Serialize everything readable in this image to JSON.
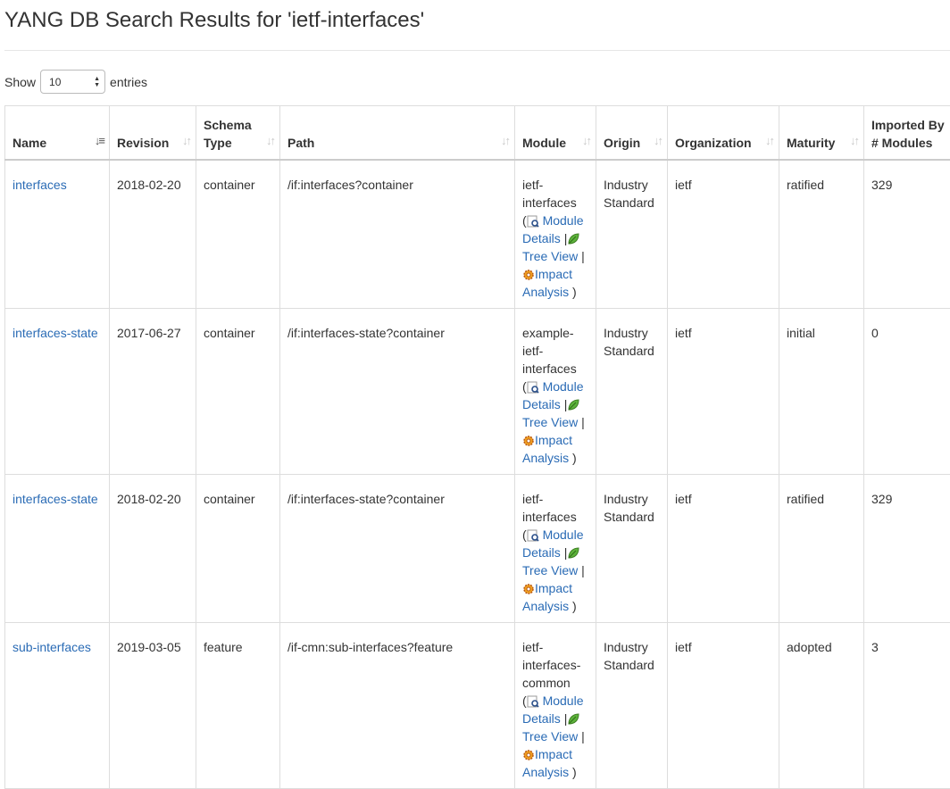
{
  "page": {
    "title": "YANG DB Search Results for 'ietf-interfaces'"
  },
  "length": {
    "show": "Show",
    "value": "10",
    "entries": "entries"
  },
  "columns": [
    "Name",
    "Revision",
    "Schema Type",
    "Path",
    "Module",
    "Origin",
    "Organization",
    "Maturity",
    "Imported By # Modules"
  ],
  "links": {
    "module_details": "Module Details",
    "tree_view": "Tree View",
    "impact_analysis": "Impact Analysis",
    "open_paren": "(",
    "close_paren": ")",
    "sep": "|"
  },
  "rows": [
    {
      "name": "interfaces",
      "revision": "2018-02-20",
      "schema_type": "container",
      "path": "/if:interfaces?container",
      "module": "ietf-interfaces",
      "origin": "Industry Standard",
      "organization": "ietf",
      "maturity": "ratified",
      "imported_by": "329"
    },
    {
      "name": "interfaces-state",
      "revision": "2017-06-27",
      "schema_type": "container",
      "path": "/if:interfaces-state?container",
      "module": "example-ietf-interfaces",
      "origin": "Industry Standard",
      "organization": "ietf",
      "maturity": "initial",
      "imported_by": "0"
    },
    {
      "name": "interfaces-state",
      "revision": "2018-02-20",
      "schema_type": "container",
      "path": "/if:interfaces-state?container",
      "module": "ietf-interfaces",
      "origin": "Industry Standard",
      "organization": "ietf",
      "maturity": "ratified",
      "imported_by": "329"
    },
    {
      "name": "sub-interfaces",
      "revision": "2019-03-05",
      "schema_type": "feature",
      "path": "/if-cmn:sub-interfaces?feature",
      "module": "ietf-interfaces-common",
      "origin": "Industry Standard",
      "organization": "ietf",
      "maturity": "adopted",
      "imported_by": "3"
    }
  ]
}
